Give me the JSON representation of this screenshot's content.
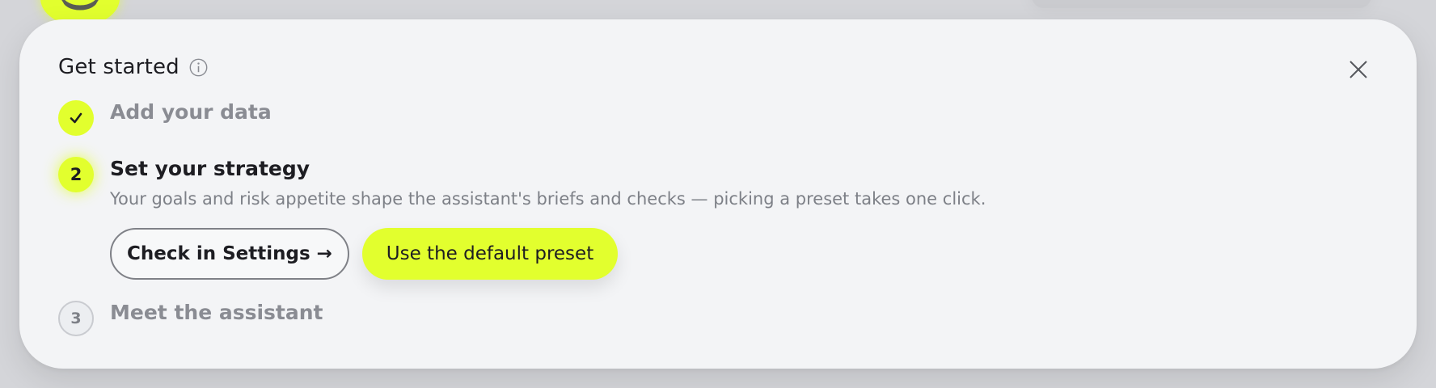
{
  "header": {
    "title": "Get started",
    "info_icon": "info-icon",
    "close_icon": "close-icon"
  },
  "steps": [
    {
      "marker": "✓",
      "label": "Add your data",
      "status": "done"
    },
    {
      "marker": "2",
      "label": "Set your strategy",
      "status": "active",
      "description": "Your goals and risk appetite shape the assistant's briefs and checks — picking a preset takes one click.",
      "buttons": {
        "secondary_label": "Check in Settings →",
        "primary_label": "Use the default preset"
      }
    },
    {
      "marker": "3",
      "label": "Meet the assistant",
      "status": "pending"
    }
  ],
  "colors": {
    "accent": "#e2ff2e",
    "background": "#f3f4f6",
    "text_primary": "#1d1d22",
    "text_muted": "#8a8c93"
  }
}
